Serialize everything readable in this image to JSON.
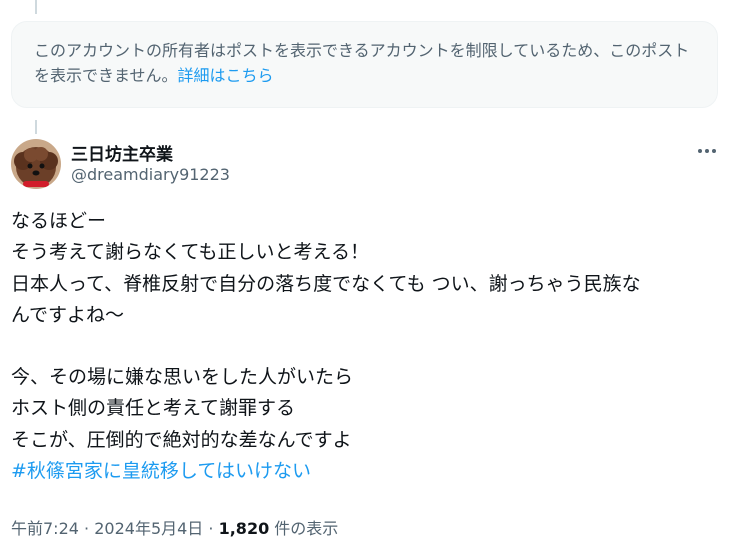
{
  "notice": {
    "text": "このアカウントの所有者はポストを表示できるアカウントを制限しているため、このポストを表示できません。",
    "link": "詳細はこちら"
  },
  "author": {
    "display_name": "三日坊主卒業",
    "handle": "@dreamdiary91223",
    "avatar_icon": "dog-avatar-icon"
  },
  "post": {
    "lines": [
      "なるほどー",
      "そう考えて謝らなくても正しいと考える！",
      "日本人って、脊椎反射で自分の落ち度でなくても つい、謝っちゃう民族な",
      "んですよね〜",
      "",
      "今、その場に嫌な思いをした人がいたら",
      "ホスト側の責任と考えて謝罪する",
      "そこが、圧倒的で絶対的な差なんですよ"
    ],
    "hashtag": "#秋篠宮家に皇統移してはいけない"
  },
  "meta": {
    "time": "午前7:24",
    "separator": "·",
    "date": "2024年5月4日",
    "views_count": "1,820",
    "views_label": "件の表示"
  },
  "colors": {
    "accent": "#1d9bf0",
    "secondary_text": "#536471",
    "notice_background": "#f7f9f9"
  }
}
